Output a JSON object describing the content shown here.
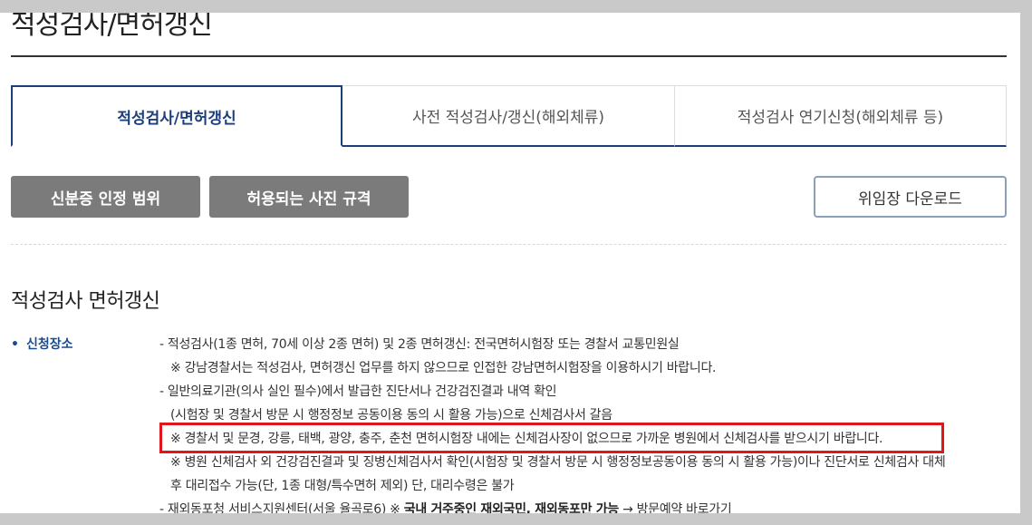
{
  "page_title": "적성검사/면허갱신",
  "tabs": [
    {
      "label": "적성검사/면허갱신",
      "active": true
    },
    {
      "label": "사전 적성검사/갱신(해외체류)",
      "active": false
    },
    {
      "label": "적성검사 연기신청(해외체류 등)",
      "active": false
    }
  ],
  "buttons": {
    "id_scope": "신분증 인정 범위",
    "photo_spec": "허용되는 사진 규격",
    "proxy_download": "위임장 다운로드"
  },
  "section": {
    "title": "적성검사 면허갱신",
    "bullet_label": "신청장소",
    "lines": [
      "- 적성검사(1종 면허, 70세 이상 2종 면허) 및 2종 면허갱신: 전국면허시험장 또는 경찰서 교통민원실",
      "※ 강남경찰서는 적성검사, 면허갱신 업무를 하지 않으므로 인접한 강남면허시험장을 이용하시기 바랍니다.",
      "- 일반의료기관(의사 실인 필수)에서 발급한 진단서나 건강검진결과 내역 확인",
      "(시험장 및 경찰서 방문 시 행정정보 공동이용 동의 시 활용 가능)으로 신체검사서 갈음",
      "※ 경찰서 및 문경, 강릉, 태백, 광양, 충주, 춘천 면허시험장 내에는 신체검사장이 없으므로 가까운 병원에서 신체검사를 받으시기 바랍니다.",
      "※ 병원 신체검사 외 건강검진결과 및 징병신체검사서 확인(시험장 및 경찰서 방문 시 행정정보공동이용 동의 시 활용 가능)이나 진단서로 신체검사 대체",
      "후 대리접수 가능(단, 1종 대형/특수면허 제외) 단, 대리수령은 불가"
    ],
    "last_line": {
      "prefix": "- 재외동포청 서비스지원센터(서울 율곡로6) ※ ",
      "strong": "국내 거주중인 재외국민, 재외동포만 가능",
      "suffix": " → 방문예약 바로가기"
    }
  },
  "colors": {
    "accent": "#1c3f7a",
    "button_gray": "#7b7b7b",
    "highlight_border": "#e0161b"
  }
}
